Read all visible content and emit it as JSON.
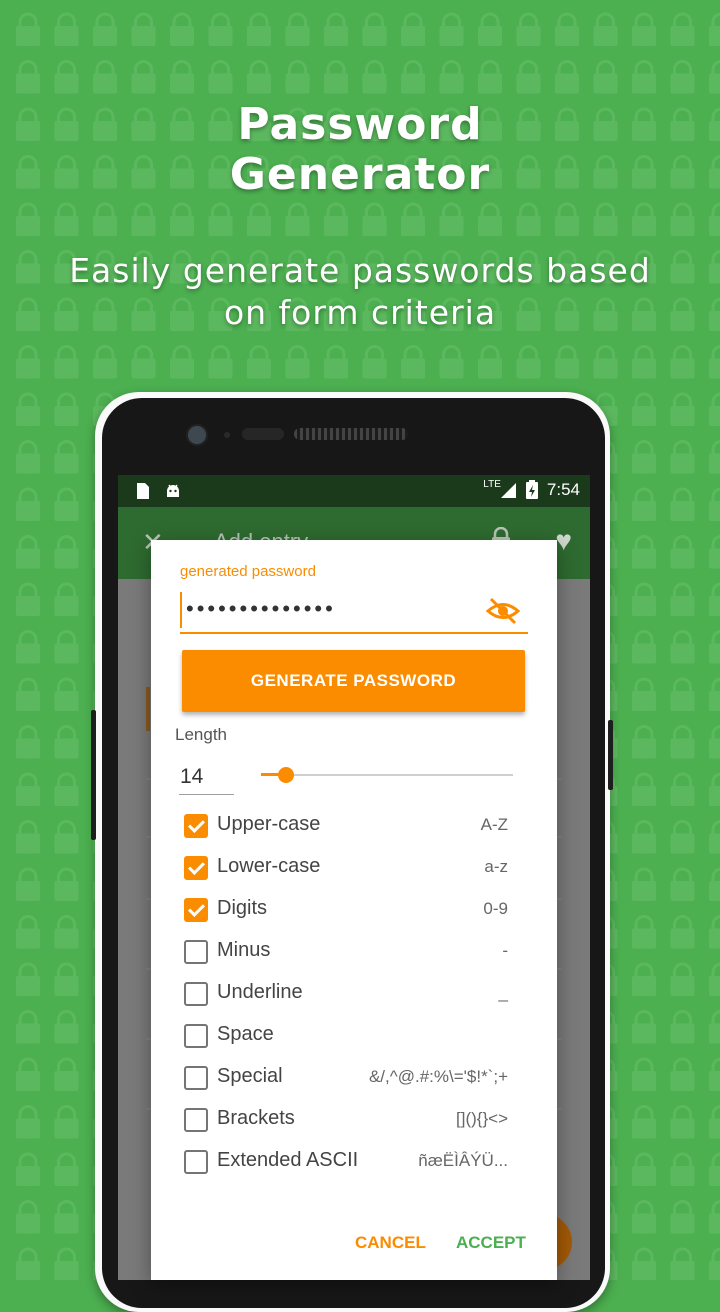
{
  "hero": {
    "title_line1": "Password",
    "title_line2": "Generator",
    "subtitle_line1": "Easily generate passwords based",
    "subtitle_line2": "on form criteria"
  },
  "statusbar": {
    "network": "LTE",
    "time": "7:54"
  },
  "appbar": {
    "title": "Add entry"
  },
  "dialog": {
    "password_label": "generated password",
    "password_masked": "••••••••••••••",
    "generate_button": "GENERATE PASSWORD",
    "length_label": "Length",
    "length_value": "14",
    "length_slider_fraction": 0.1,
    "options": [
      {
        "label": "Upper-case",
        "chars": "A-Z",
        "checked": true
      },
      {
        "label": "Lower-case",
        "chars": "a-z",
        "checked": true
      },
      {
        "label": "Digits",
        "chars": "0-9",
        "checked": true
      },
      {
        "label": "Minus",
        "chars": "-",
        "checked": false
      },
      {
        "label": "Underline",
        "chars": "_",
        "checked": false
      },
      {
        "label": "Space",
        "chars": "",
        "checked": false
      },
      {
        "label": "Special",
        "chars": "&/,^@.#:%\\='$!*`;+",
        "checked": false
      },
      {
        "label": "Brackets",
        "chars": "[](){}<>",
        "checked": false
      },
      {
        "label": "Extended ASCII",
        "chars": "ñæËÌÂÝÜ...",
        "checked": false
      }
    ],
    "cancel_button": "CANCEL",
    "accept_button": "ACCEPT"
  },
  "colors": {
    "background": "#4caf50",
    "accent": "#fb8c00",
    "accept": "#4caf50"
  },
  "icons": {
    "background_pattern": "lock-icon",
    "visibility_toggle": "eye-off-icon"
  }
}
